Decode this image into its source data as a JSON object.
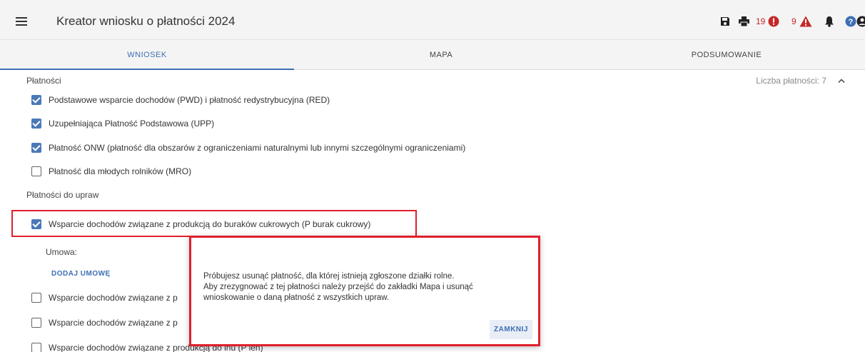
{
  "header": {
    "title": "Kreator wniosku o płatności 2024",
    "errors_count": "19",
    "warnings_count": "9",
    "icons": [
      "menu-icon",
      "save-icon",
      "print-icon",
      "error-icon",
      "warning-icon",
      "bell-icon",
      "help-icon",
      "account-icon"
    ]
  },
  "tabs": [
    {
      "label": "WNIOSEK",
      "active": true
    },
    {
      "label": "MAPA",
      "active": false
    },
    {
      "label": "PODSUMOWANIE",
      "active": false
    }
  ],
  "payments": {
    "section_title": "Płatności",
    "count_label": "Liczba płatności: 7",
    "items": [
      {
        "label": "Podstawowe wsparcie dochodów (PWD) i płatność redystrybucyjna (RED)",
        "checked": true
      },
      {
        "label": "Uzupełniająca Płatność Podstawowa (UPP)",
        "checked": true
      },
      {
        "label": "Płatność ONW (płatność dla obszarów z ograniczeniami naturalnymi lub innymi szczególnymi ograniczeniami)",
        "checked": true
      },
      {
        "label": "Płatność dla młodych rolników (MRO)",
        "checked": false
      }
    ]
  },
  "crop_payments": {
    "section_title": "Płatności do upraw",
    "highlighted": {
      "label": "Wsparcie dochodów związane z produkcją do buraków cukrowych (P burak cukrowy)",
      "checked": true
    },
    "contract_label": "Umowa:",
    "add_contract": "DODAJ UMOWĘ",
    "items": [
      {
        "label": "Wsparcie dochodów związane z p",
        "checked": false
      },
      {
        "label": "Wsparcie dochodów związane z p",
        "checked": false
      },
      {
        "label": "Wsparcie dochodów związane z produkcją do lnu (P len)",
        "checked": false
      }
    ]
  },
  "dialog": {
    "line1": "Próbujesz usunąć płatność, dla której istnieją zgłoszone działki rolne.",
    "line2": "Aby zrezygnować z tej płatności należy przejść do zakładki Mapa i usunąć",
    "line3": "wnioskowanie o daną płatność z wszystkich upraw.",
    "close_label": "ZAMKNIJ"
  },
  "colors": {
    "accent": "#3d6fb4",
    "highlight": "#e0202c",
    "error": "#c62828"
  }
}
